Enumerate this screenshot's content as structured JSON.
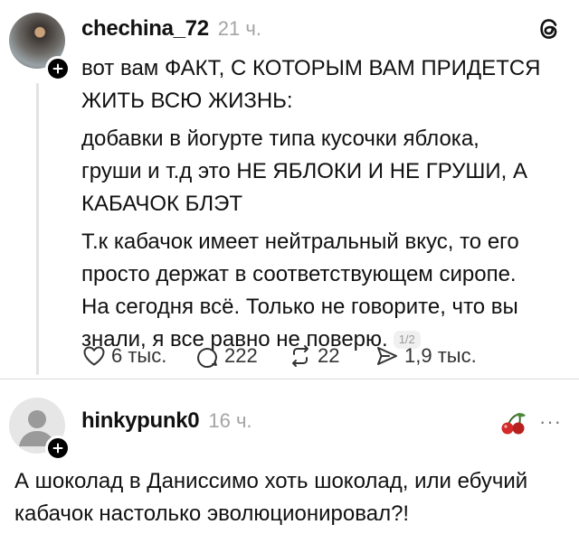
{
  "post": {
    "author": "chechina_72",
    "time": "21 ч.",
    "lines": [
      "вот вам ФАКТ, С КОТОРЫМ ВАМ ПРИДЕТСЯ",
      "ЖИТЬ ВСЮ ЖИЗНЬ:",
      "добавки в йогурте типа кусочки яблока,",
      "груши и т.д это НЕ ЯБЛОКИ И НЕ ГРУШИ, А",
      "КАБАЧОК БЛЭТ",
      "Т.к кабачок имеет нейтральный вкус, то его",
      "просто держат в соответствующем сиропе.",
      "На сегодня всё. Только не говорите, что вы",
      "знали, я все равно не поверю."
    ],
    "counter": "1/2",
    "actions": {
      "likes": "6 тыс.",
      "comments": "222",
      "reposts": "22",
      "shares": "1,9 тыс."
    }
  },
  "reply": {
    "author": "hinkypunk0",
    "time": "16 ч.",
    "more": "···",
    "lines": [
      "А шоколад в Даниссимо хоть шоколад, или ебучий",
      "кабачок настолько эволюционировал?!"
    ]
  },
  "icons": [
    "threads-logo-icon",
    "plus-icon",
    "heart-icon",
    "comment-icon",
    "repost-icon",
    "share-icon",
    "avatar-placeholder-icon",
    "cherry-emoji-icon",
    "more-icon"
  ]
}
